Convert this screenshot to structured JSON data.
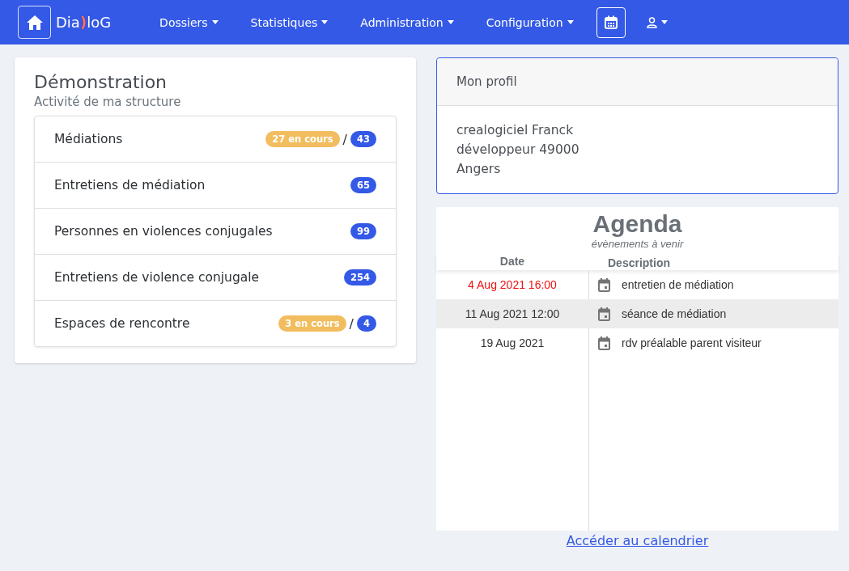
{
  "navbar": {
    "logo": [
      {
        "text": "Dia",
        "accent": false
      },
      {
        "text": ")",
        "accent": true
      },
      {
        "text": "loG",
        "accent": false
      }
    ],
    "menus": [
      "Dossiers",
      "Statistiques",
      "Administration",
      "Configuration"
    ]
  },
  "activity": {
    "title": "Démonstration",
    "subtitle": "Activité de ma structure",
    "items": [
      {
        "label": "Médiations",
        "ongoing": "27 en cours",
        "separator": "/",
        "total": "43"
      },
      {
        "label": "Entretiens de médiation",
        "total": "65"
      },
      {
        "label": "Personnes en violences conjugales",
        "total": "99"
      },
      {
        "label": "Entretiens de violence conjugale",
        "total": "254"
      },
      {
        "label": "Espaces de rencontre",
        "ongoing": "3 en cours",
        "separator": "/",
        "total": "4"
      }
    ]
  },
  "profile": {
    "header": "Mon profil",
    "lines": [
      "crealogiciel Franck",
      "développeur 49000",
      "Angers"
    ]
  },
  "agenda": {
    "title": "Agenda",
    "subtitle": "évènements à venir",
    "columns": [
      "Date",
      "Description"
    ],
    "rows": [
      {
        "date": "4 Aug 2021 16:00",
        "description": "entretien de médiation",
        "overdue": true,
        "selected": false
      },
      {
        "date": "11 Aug 2021 12:00",
        "description": "séance de médiation",
        "overdue": false,
        "selected": true
      },
      {
        "date": "19 Aug 2021",
        "description": "rdv préalable parent visiteur",
        "overdue": false,
        "selected": false
      }
    ],
    "link": "Accéder au calendrier"
  }
}
